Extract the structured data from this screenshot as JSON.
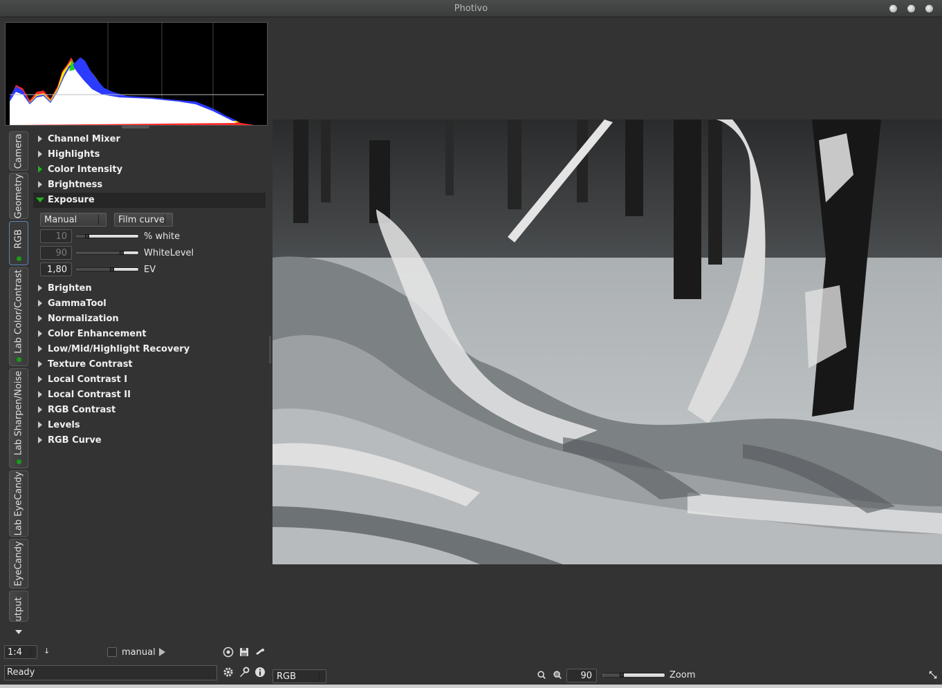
{
  "window": {
    "title": "Photivo"
  },
  "tabs": [
    {
      "label": "Camera",
      "active": false,
      "indicator": false
    },
    {
      "label": "Geometry",
      "active": false,
      "indicator": false
    },
    {
      "label": "RGB",
      "active": true,
      "indicator": true
    },
    {
      "label": "Lab Color/Contrast",
      "active": false,
      "indicator": true
    },
    {
      "label": "Lab Sharpen/Noise",
      "active": false,
      "indicator": true
    },
    {
      "label": "Lab EyeCandy",
      "active": false,
      "indicator": false
    },
    {
      "label": "EyeCandy",
      "active": false,
      "indicator": false
    },
    {
      "label": "utput",
      "active": false,
      "indicator": false
    }
  ],
  "filters_top": [
    {
      "label": "Channel Mixer",
      "state": "collapsed"
    },
    {
      "label": "Highlights",
      "state": "collapsed"
    },
    {
      "label": "Color Intensity",
      "state": "active"
    },
    {
      "label": "Brightness",
      "state": "collapsed"
    },
    {
      "label": "Exposure",
      "state": "expanded"
    }
  ],
  "exposure": {
    "mode": "Manual",
    "curve": "Film curve",
    "controls": [
      {
        "value": "10",
        "label": "% white",
        "enabled": false,
        "level": 0.15
      },
      {
        "value": "90",
        "label": "WhiteLevel",
        "enabled": false,
        "level": 0.75
      },
      {
        "value": "1,80",
        "label": "EV",
        "enabled": true,
        "level": 0.58
      }
    ]
  },
  "filters_bottom": [
    {
      "label": "Brighten"
    },
    {
      "label": "GammaTool"
    },
    {
      "label": "Normalization"
    },
    {
      "label": "Color Enhancement"
    },
    {
      "label": "Low/Mid/Highlight Recovery"
    },
    {
      "label": "Texture Contrast"
    },
    {
      "label": "Local Contrast I"
    },
    {
      "label": "Local Contrast II"
    },
    {
      "label": "RGB Contrast"
    },
    {
      "label": "Levels"
    },
    {
      "label": "RGB Curve"
    }
  ],
  "bottom": {
    "pipe_size": "1:4",
    "manual_label": "manual",
    "status": "Ready",
    "colorspace": "RGB",
    "zoom_value": "90",
    "zoom_label": "Zoom",
    "zoom_level": 0.3
  },
  "colors": {
    "accent_green": "#22b022",
    "tab_active_border": "#5b86b8",
    "background": "#333333"
  }
}
